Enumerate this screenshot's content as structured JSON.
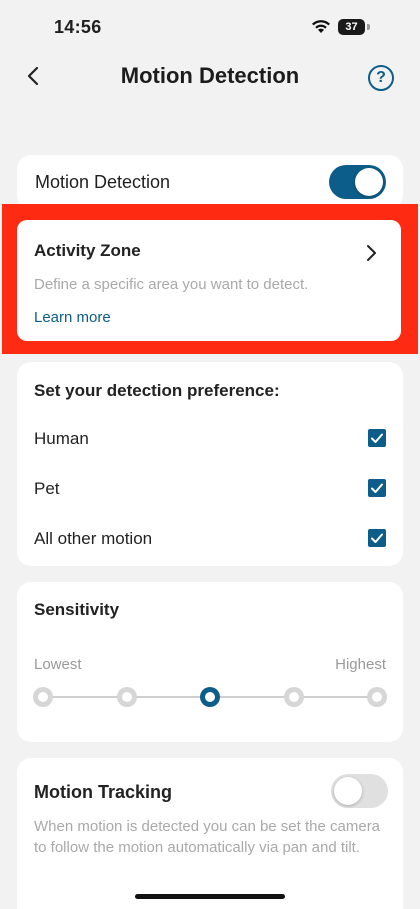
{
  "status_bar": {
    "time": "14:56",
    "battery": "37"
  },
  "nav": {
    "title": "Motion Detection",
    "help_glyph": "?"
  },
  "motion_detection": {
    "label": "Motion Detection",
    "enabled": true
  },
  "activity_zone": {
    "title": "Activity Zone",
    "description": "Define a specific area you want to detect.",
    "link": "Learn more"
  },
  "detection_preference": {
    "title": "Set your detection preference:",
    "options": [
      {
        "label": "Human",
        "checked": true
      },
      {
        "label": "Pet",
        "checked": true
      },
      {
        "label": "All other motion",
        "checked": true
      }
    ]
  },
  "sensitivity": {
    "title": "Sensitivity",
    "low_label": "Lowest",
    "high_label": "Highest",
    "levels": 5,
    "selected_level": 3
  },
  "motion_tracking": {
    "title": "Motion Tracking",
    "enabled": false,
    "description": "When motion is detected you can be set the camera to follow the motion automatically via pan and tilt."
  },
  "colors": {
    "accent": "#0d5d8a",
    "highlight": "#ff2a12",
    "background": "#f2f2f2"
  },
  "icons": [
    "wifi-icon",
    "battery-icon",
    "back-chevron-icon",
    "help-icon",
    "chevron-right-icon",
    "checkbox-checked-icon"
  ]
}
